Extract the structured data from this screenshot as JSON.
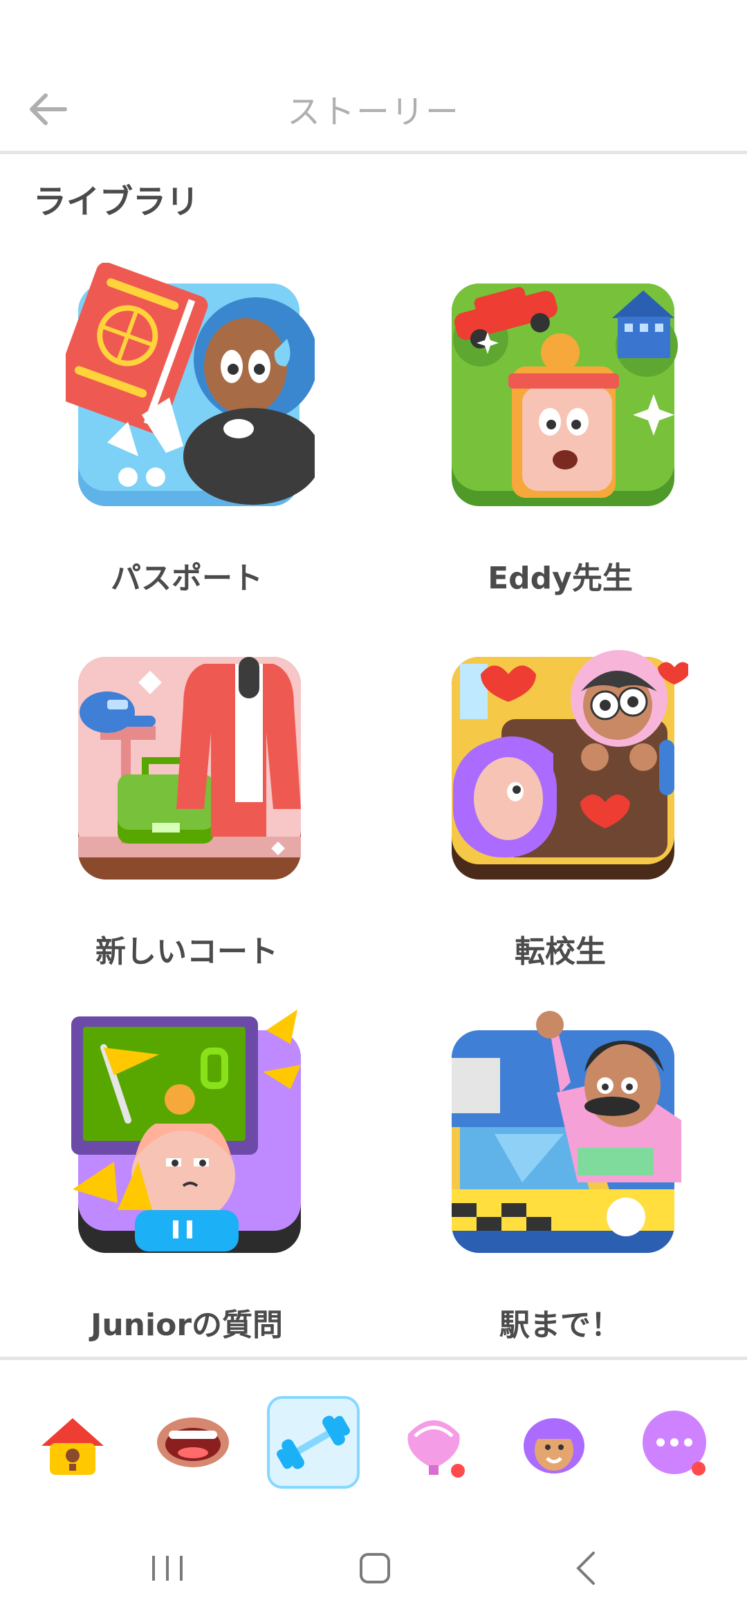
{
  "header": {
    "title": "ストーリー",
    "back_icon": "arrow-left-icon"
  },
  "library": {
    "title": "ライブラリ"
  },
  "stories": [
    {
      "title": "パスポート",
      "icon": "passport-story-art"
    },
    {
      "title": "Eddy先生",
      "icon": "teacher-eddy-story-art"
    },
    {
      "title": "新しいコート",
      "icon": "new-coat-story-art"
    },
    {
      "title": "転校生",
      "icon": "transfer-student-story-art"
    },
    {
      "title": "Juniorの質問",
      "icon": "junior-question-story-art"
    },
    {
      "title": "駅まで！",
      "icon": "to-the-station-story-art"
    }
  ],
  "tabs": [
    {
      "icon": "home-icon"
    },
    {
      "icon": "mouth-icon"
    },
    {
      "icon": "dumbbell-icon",
      "active": true
    },
    {
      "icon": "shell-icon"
    },
    {
      "icon": "character-icon"
    },
    {
      "icon": "more-icon"
    }
  ],
  "colors": {
    "accent_blue": "#1cb0f6",
    "divider": "#e5e5e5",
    "text": "#4b4b4b",
    "muted": "#afafaf",
    "notification_red": "#ff4b4b"
  }
}
